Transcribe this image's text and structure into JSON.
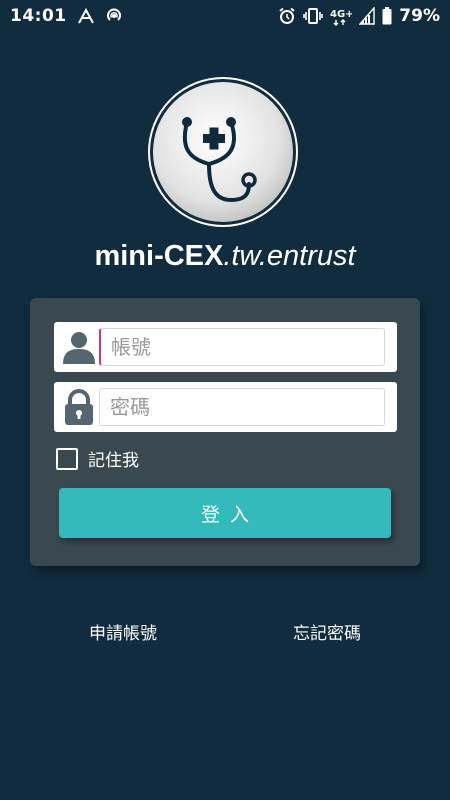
{
  "status_bar": {
    "time": "14:01",
    "battery_percent": "79%",
    "icons": [
      "assistant-icon",
      "hotspot-icon",
      "alarm-icon",
      "vibrate-icon",
      "4g-plus-icon",
      "signal-icon",
      "battery-icon"
    ],
    "network_label": "4G+"
  },
  "app": {
    "logo_icon": "stethoscope-medical-cross-icon",
    "title_main": "mini-CEX",
    "title_sub": ".tw.entrust"
  },
  "login": {
    "username_placeholder": "帳號",
    "username_value": "",
    "username_icon": "user-icon",
    "password_placeholder": "密碼",
    "password_value": "",
    "password_icon": "lock-icon",
    "remember_label": "記住我",
    "remember_checked": false,
    "submit_label": "登入"
  },
  "links": {
    "apply_account": "申請帳號",
    "forgot_password": "忘記密碼"
  },
  "colors": {
    "background": "#112c3f",
    "card": "#3a4850",
    "accent": "#34b9bd",
    "icon_gray": "#556670"
  }
}
